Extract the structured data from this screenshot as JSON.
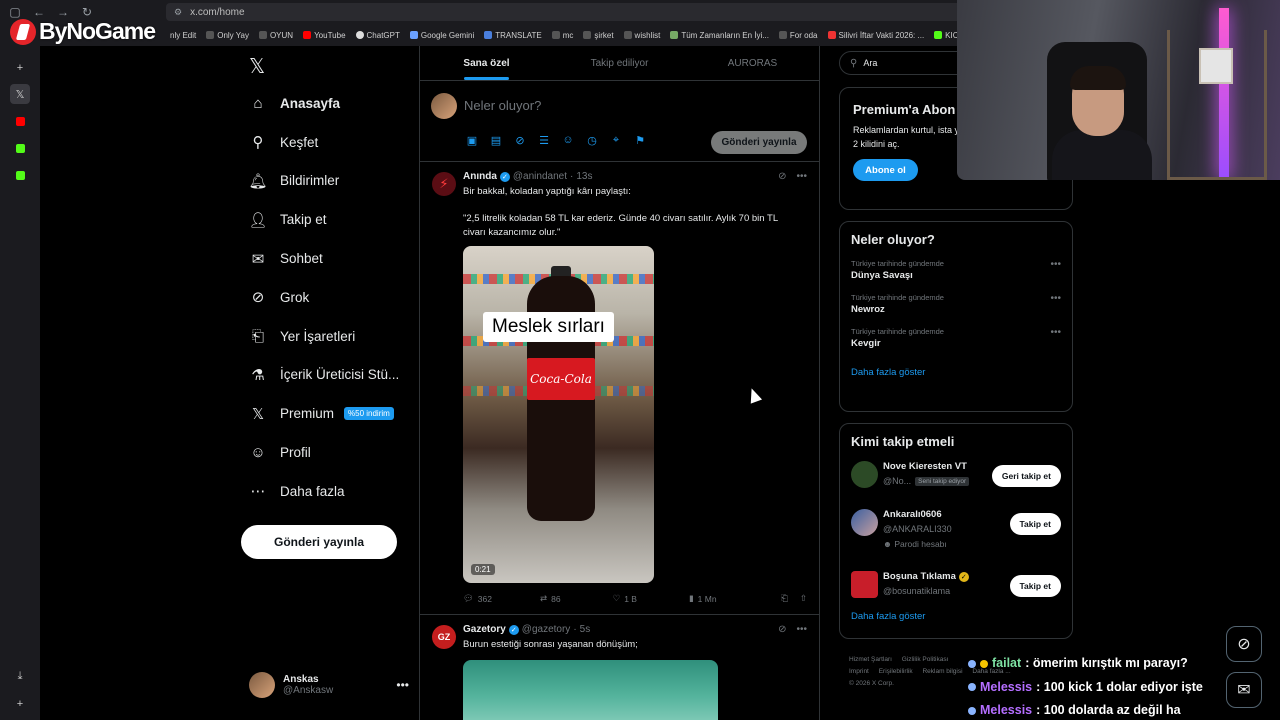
{
  "browser": {
    "url": "x.com/home",
    "bookmarks": [
      "nly Edit",
      "Only Yay",
      "OYUN",
      "YouTube",
      "ChatGPT",
      "Google Gemini",
      "TRANSLATE",
      "mc",
      "şirket",
      "wishlist",
      "Tüm Zamanların En İyi...",
      "For oda",
      "Silivri İftar Vakti 2026: ...",
      "KIC"
    ]
  },
  "overlay": {
    "logo_text": "ByNoGame"
  },
  "nav": {
    "items": [
      {
        "label": "Anasayfa",
        "icon": "home-icon"
      },
      {
        "label": "Keşfet",
        "icon": "search-icon"
      },
      {
        "label": "Bildirimler",
        "icon": "bell-icon"
      },
      {
        "label": "Takip et",
        "icon": "person-add-icon"
      },
      {
        "label": "Sohbet",
        "icon": "envelope-icon"
      },
      {
        "label": "Grok",
        "icon": "grok-icon"
      },
      {
        "label": "Yer İşaretleri",
        "icon": "bookmark-icon"
      },
      {
        "label": "İçerik Üreticisi Stü...",
        "icon": "flask-icon"
      },
      {
        "label": "Premium",
        "icon": "x-logo-icon"
      },
      {
        "label": "Profil",
        "icon": "person-icon"
      },
      {
        "label": "Daha fazla",
        "icon": "more-circle-icon"
      }
    ],
    "premium_badge": "%50 indirim",
    "post_button": "Gönderi yayınla"
  },
  "account": {
    "name": "Anskas",
    "handle": "@Anskasw"
  },
  "timeline": {
    "tabs": [
      "Sana özel",
      "Takip ediliyor",
      "AURORAS"
    ],
    "compose_placeholder": "Neler oluyor?",
    "compose_button": "Gönderi yayınla",
    "tweets": [
      {
        "name": "Anında",
        "handle": "@anindanet",
        "time": "13s",
        "line1": "Bir bakkal, koladan yaptığı kârı paylaştı:",
        "line2": "\"2,5 litrelik koladan 58 TL kar ederiz. Günde 40 civarı satılır. Aylık 70 bin TL civarı kazancımız olur.\"",
        "media_caption": "Meslek sırları",
        "media_brand": "Coca-Cola",
        "video_time": "0:21",
        "replies": "362",
        "reposts": "86",
        "likes": "1 B",
        "views": "1 Mn"
      },
      {
        "name": "Gazetory",
        "handle": "@gazetory",
        "time": "5s",
        "line1": "Burun estetiği sonrası yaşanan dönüşüm;"
      }
    ]
  },
  "right": {
    "search_placeholder": "Ara",
    "premium": {
      "title": "Premium'a Abon",
      "desc": "Reklamlardan kurtul, ista yanıtlarını öne çıkar ve 2 kilidini aç.",
      "button": "Abone ol"
    },
    "trends": {
      "title": "Neler oluyor?",
      "items": [
        {
          "category": "Türkiye tarihinde gündemde",
          "name": "Dünya Savaşı"
        },
        {
          "category": "Türkiye tarihinde gündemde",
          "name": "Newroz"
        },
        {
          "category": "Türkiye tarihinde gündemde",
          "name": "Kevgir"
        }
      ],
      "show_more": "Daha fazla göster"
    },
    "who_to_follow": {
      "title": "Kimi takip etmeli",
      "items": [
        {
          "name": "Nove Kieresten VT",
          "handle": "@No...",
          "tag": "Seni takip ediyor",
          "button": "Geri takip et"
        },
        {
          "name": "Ankaralı0606",
          "handle": "@ANKARALI330",
          "sub": "Parodi hesabı",
          "button": "Takip et"
        },
        {
          "name": "Boşuna Tıklama",
          "handle": "@bosunatiklama",
          "button": "Takip et"
        }
      ],
      "show_more": "Daha fazla göster"
    },
    "footer": [
      "Hizmet Şartları",
      "Gizlilik Politikası",
      "Erişilebilirlik",
      "Reklam bilgisi",
      "Daha fazla ...",
      "Imprint",
      "© 2026 X Corp."
    ]
  },
  "chat": [
    {
      "user": "failat",
      "msg": ": ömerim kırıştık mı parayı?"
    },
    {
      "user": "Melessis",
      "msg": ": 100 kick 1 dolar ediyor işte"
    },
    {
      "user": "Melessis",
      "msg": ": 100 dolarda az değil ha"
    }
  ],
  "colors": {
    "accent": "#1d9bf0",
    "background": "#000000",
    "border": "#2f3336",
    "muted": "#71767b"
  }
}
